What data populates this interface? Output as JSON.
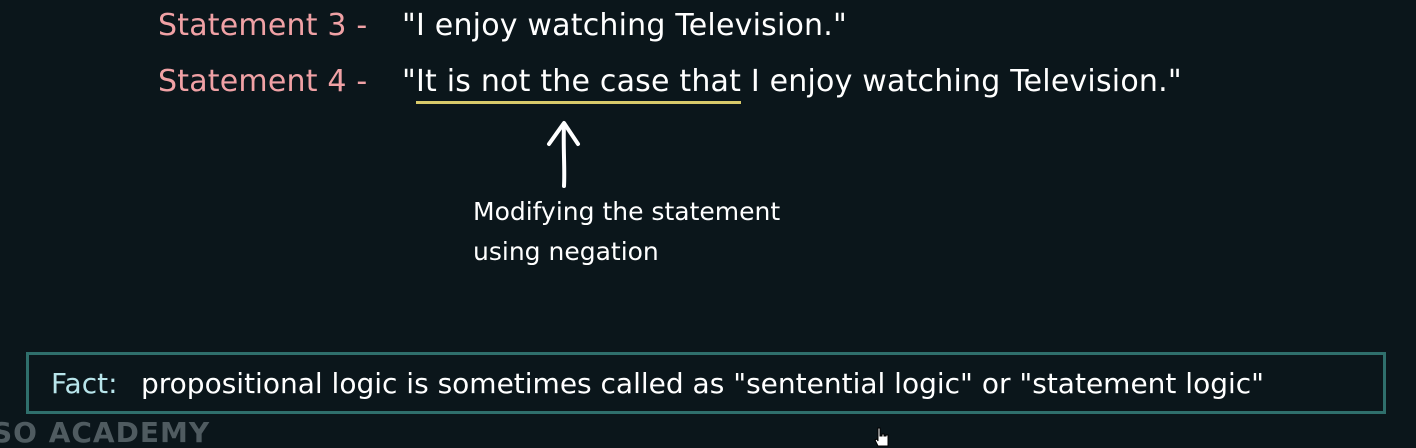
{
  "statement3": {
    "label": "Statement 3 -",
    "text": "\"I enjoy watching Television.\""
  },
  "statement4": {
    "label": "Statement 4 -",
    "text_open_quote": "\"",
    "text_underlined": "It is not the case that",
    "text_rest": " I enjoy watching Television.\""
  },
  "annotation": {
    "line1": "Modifying the statement",
    "line2": "using negation"
  },
  "fact": {
    "label": "Fact:",
    "text": "propositional logic is sometimes called as \"sentential logic\" or \"statement logic\""
  },
  "watermark": "SO ACADEMY",
  "colors": {
    "background": "#0b161b",
    "statement_label": "#f0a1a5",
    "underline": "#d8c96a",
    "fact_label": "#b8e5eb",
    "fact_border": "#2f6f6c"
  }
}
